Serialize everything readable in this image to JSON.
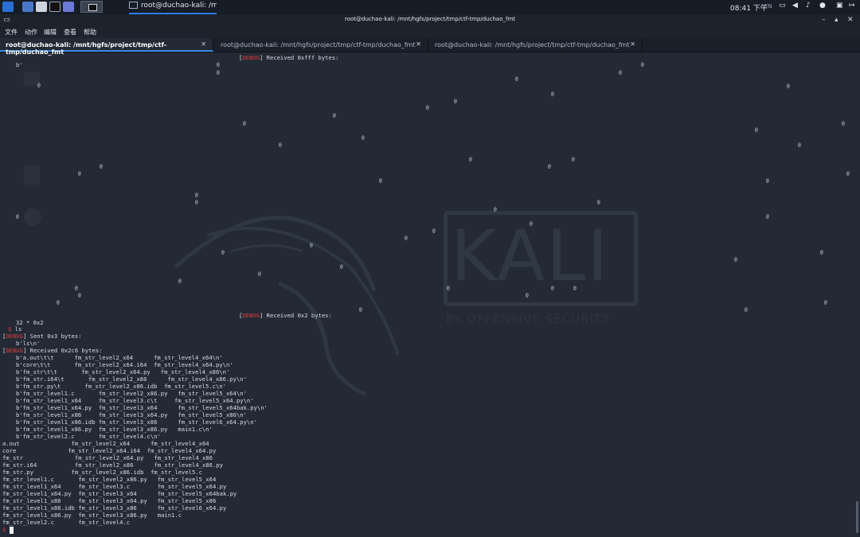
{
  "taskbar": {
    "window_title": "root@duchao-kali: /mnt/...",
    "clock": "08:41 下午",
    "lang": "EN"
  },
  "window": {
    "title": "root@duchao-kali: /mnt/hgfs/project/tmp/ctf-tmp/duchao_fmt"
  },
  "menubar": {
    "items": [
      "文件",
      "动作",
      "编辑",
      "查看",
      "帮助"
    ]
  },
  "tabs": [
    {
      "label": "root@duchao-kali: /mnt/hgfs/project/tmp/ctf-tmp/duchao_fmt",
      "active": true
    },
    {
      "label": "root@duchao-kali: /mnt/hgfs/project/tmp/ctf-tmp/duchao_fmt",
      "active": false
    },
    {
      "label": "root@duchao-kali: /mnt/hgfs/project/tmp/ctf-tmp/duchao_fmt",
      "active": false
    }
  ],
  "terminal": {
    "debug_tag": "DEBUG",
    "received_fff": " Received 0xfff bytes:",
    "b_quote": "b'",
    "at_char": "@",
    "received_2": " Received 0x2 bytes:",
    "mul_line": "32 * 0x2",
    "prompt_symbol": "$",
    "ls_cmd": " ls",
    "sent_3": " Sent 0x3 bytes:",
    "bls": "b'ls\\n'",
    "received_2c6": " Received 0x2c6 bytes:",
    "bytes_lines": [
      "b'a.out\\t\\t      fm_str_level2_x64      fm_str_level4_x64\\n'",
      "b'core\\t\\t       fm_str_level2_x64.i64  fm_str_level4_x64.py\\n'",
      "b'fm_str\\t\\t       fm_str_level2_x64.py   fm_str_level4_x86\\n'",
      "b'fm_str.i64\\t       fm_str_level2_x86      fm_str_level4_x86.py\\n'",
      "b'fm_str.py\\t       fm_str_level2_x86.idb  fm_str_level5.c\\n'",
      "b'fm_str_level1.c       fm_str_level2_x86.py   fm_str_level5_x64\\n'",
      "b'fm_str_level1_x64     fm_str_level3.c\\t     fm_str_level5_x64.py\\n'",
      "b'fm_str_level1_x64.py  fm_str_level3_x64      fm_str_level5_x64bak.py\\n'",
      "b'fm_str_level1_x86     fm_str_level3_x64.py   fm_str_level5_x86\\n'",
      "b'fm_str_level1_x86.idb fm_str_level3_x86      fm_str_level6_x64.py\\n'",
      "b'fm_str_level1_x86.py  fm_str_level3_x86.py   main1.c\\n'",
      "b'fm_str_level2.c       fm_str_level4.c\\n'"
    ],
    "ls_lines": [
      "a.out               fm_str_level2_x64      fm_str_level4_x64",
      "core               fm_str_level2_x64.i64  fm_str_level4_x64.py",
      "fm_str               fm_str_level2_x64.py   fm_str_level4_x86",
      "fm_str.i64           fm_str_level2_x86      fm_str_level4_x86.py",
      "fm_str.py           fm_str_level2_x86.idb  fm_str_level5.c",
      "fm_str_level1.c       fm_str_level2_x86.py   fm_str_level5_x64",
      "fm_str_level1_x64     fm_str_level3.c        fm_str_level5_x64.py",
      "fm_str_level1_x64.py  fm_str_level3_x64      fm_str_level5_x64bak.py",
      "fm_str_level1_x86     fm_str_level3_x64.py   fm_str_level5_x86",
      "fm_str_level1_x86.idb fm_str_level3_x86      fm_str_level6_x64.py",
      "fm_str_level1_x86.py  fm_str_level3_x86.py   main1.c",
      "fm_str_level2.c       fm_str_level4.c"
    ]
  },
  "wallpaper": {
    "logo_text": "KALI",
    "logo_sub": "BY OFFENSIVE SECURITY"
  },
  "colors": {
    "background": "#232a35",
    "debug_red": "#e23b3b",
    "accent_blue": "#3a8ee6"
  }
}
